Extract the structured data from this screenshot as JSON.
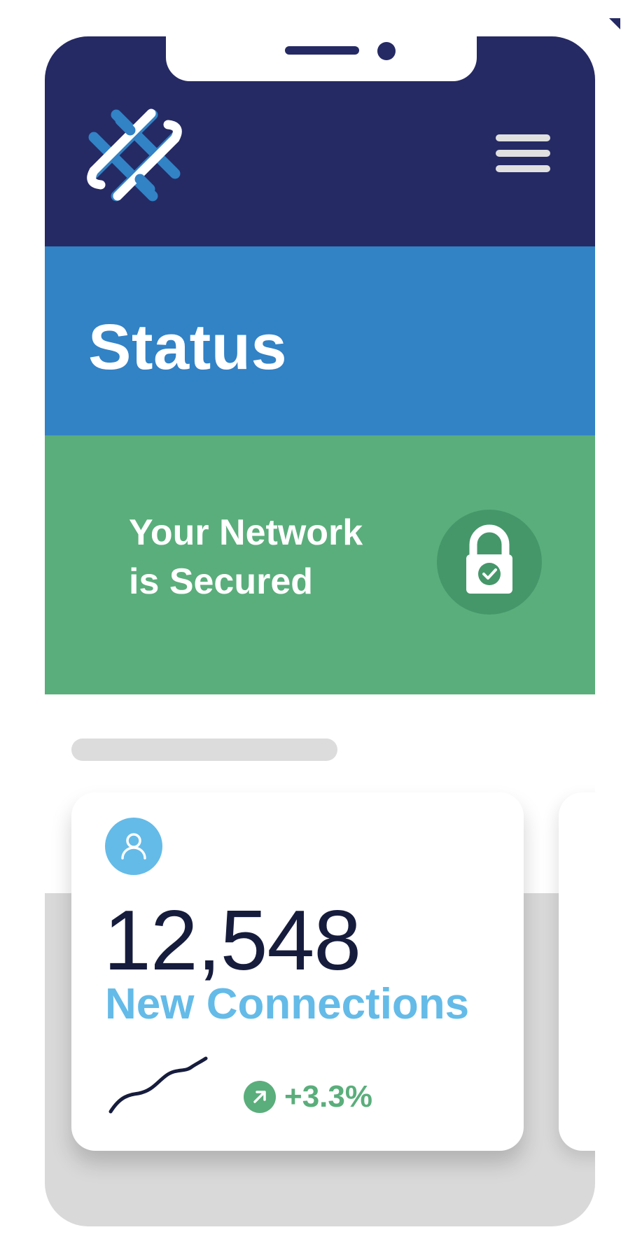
{
  "header": {
    "logo_icon": "woven-knot-logo",
    "menu_icon": "hamburger-menu-icon",
    "colors": {
      "navy": "#252a64",
      "logo_blue": "#3282c6"
    }
  },
  "page": {
    "title": "Status",
    "title_band_color": "#3282c6"
  },
  "security": {
    "status_line1": "Your Network",
    "status_line2": "is Secured",
    "icon": "padlock-check-icon",
    "band_color": "#5aae7b"
  },
  "stats": {
    "cards": [
      {
        "icon": "user-icon",
        "value": "12,548",
        "label": "New Connections",
        "trend_icon": "arrow-up-right-icon",
        "trend": "+3.3%",
        "label_color": "#64bbe8",
        "trend_color": "#5aae7b"
      }
    ]
  }
}
